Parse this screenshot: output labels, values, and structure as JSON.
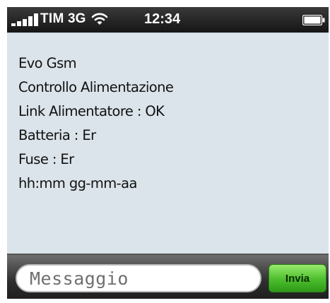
{
  "status_bar": {
    "carrier": "TIM",
    "network": "3G",
    "time": "12:34",
    "icons": [
      "signal-bars-icon",
      "wifi-icon",
      "battery-icon"
    ]
  },
  "messages": [
    "Evo Gsm",
    "Controllo Alimentazione",
    "Link Alimentatore : OK",
    "Batteria : Er",
    "Fuse : Er",
    "hh:mm gg-mm-aa"
  ],
  "input_bar": {
    "placeholder": "Messaggio",
    "send_label": "Invia"
  },
  "colors": {
    "content_background": "#dbe4ea",
    "send_button": "#4cbd2d",
    "status_bar": "#1f1f1f"
  }
}
